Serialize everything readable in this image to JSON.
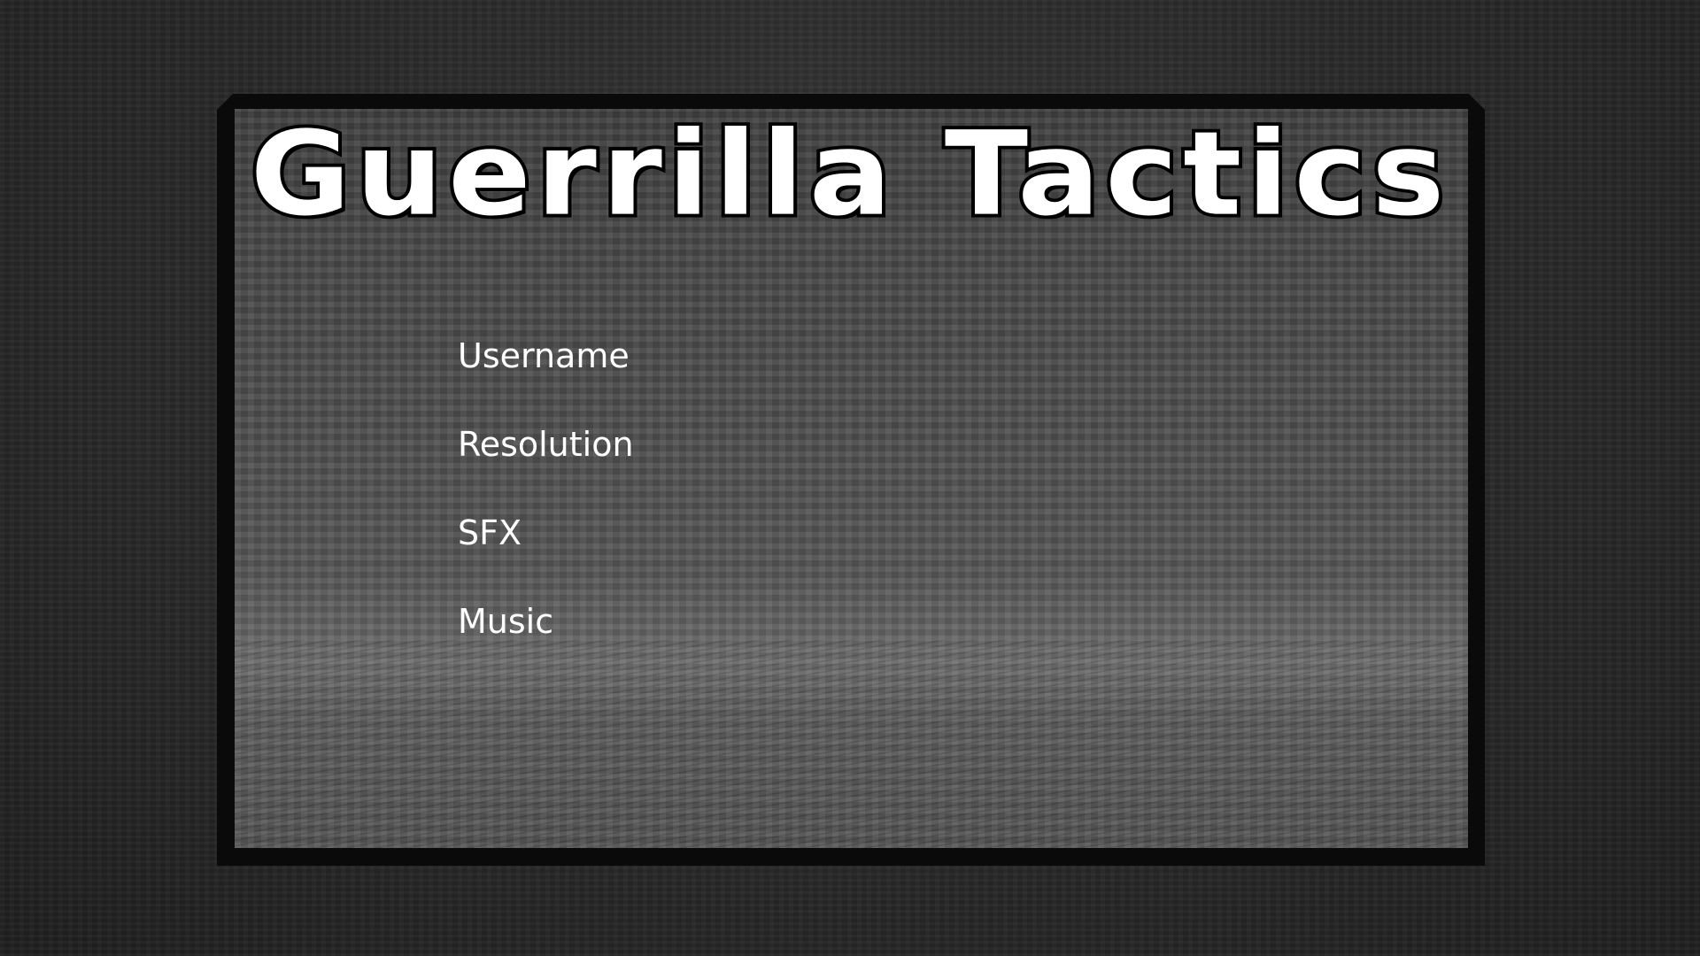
{
  "game": {
    "title": "Guerrilla Tactics"
  },
  "menu": {
    "items": [
      {
        "label": "Username"
      },
      {
        "label": "Resolution"
      },
      {
        "label": "SFX"
      },
      {
        "label": "Music"
      }
    ]
  },
  "colors": {
    "text": "#ffffff",
    "title_outline": "#000000",
    "frame": "#0a0a0a",
    "background": "#2b2b2b"
  }
}
